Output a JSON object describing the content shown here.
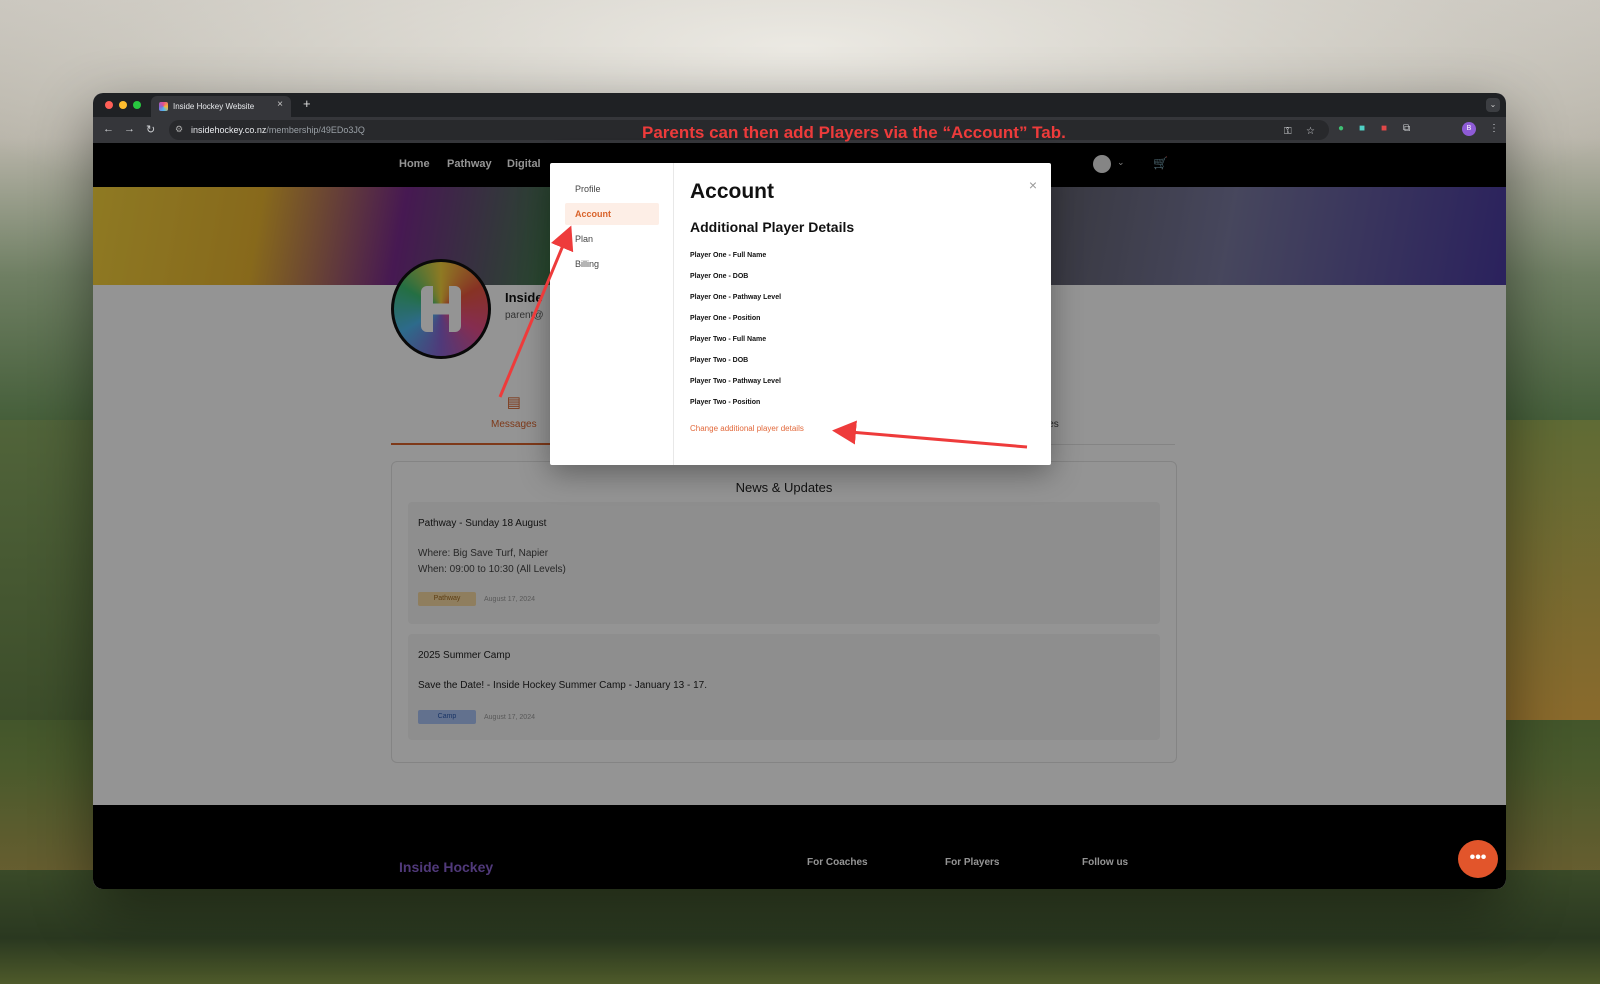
{
  "browser": {
    "tab_title": "Inside Hockey Website",
    "tab_close": "×",
    "new_tab": "+",
    "address_domain": "insidehockey.co.nz",
    "address_path": "/membership/49EDo3JQ",
    "annotation": "Parents can then add Players via the “Account” Tab.",
    "profile_initial": "B"
  },
  "site_nav": {
    "links": [
      "Home",
      "Pathway",
      "Digital"
    ]
  },
  "profile": {
    "name": "Inside",
    "email": "parent@"
  },
  "profile_tabs": {
    "messages": "Messages",
    "resources": "Resources"
  },
  "news": {
    "title": "News & Updates",
    "items": [
      {
        "title": "Pathway - Sunday 18 August",
        "line1": "Where: Big Save Turf, Napier",
        "line2": "When: 09:00 to 10:30 (All Levels)",
        "tag": "Pathway",
        "date": "August 17, 2024"
      },
      {
        "title": "2025 Summer Camp",
        "line1": "Save the Date! - Inside Hockey Summer Camp - January 13 - 17.",
        "tag": "Camp",
        "date": "August 17, 2024"
      }
    ]
  },
  "footer": {
    "logo": "Inside Hockey",
    "links": [
      "For Coaches",
      "For Players",
      "Follow us"
    ]
  },
  "modal": {
    "menu": [
      "Profile",
      "Account",
      "Plan",
      "Billing"
    ],
    "active_menu": "Account",
    "title": "Account",
    "subtitle": "Additional Player Details",
    "fields": [
      "Player One - Full Name",
      "Player One - DOB",
      "Player One - Pathway Level",
      "Player One - Position",
      "Player Two - Full Name",
      "Player Two - DOB",
      "Player Two - Pathway Level",
      "Player Two - Position"
    ],
    "change_link": "Change additional player details",
    "close": "×"
  },
  "colors": {
    "accent": "#d9632b",
    "annotation": "#ee3b3b"
  }
}
